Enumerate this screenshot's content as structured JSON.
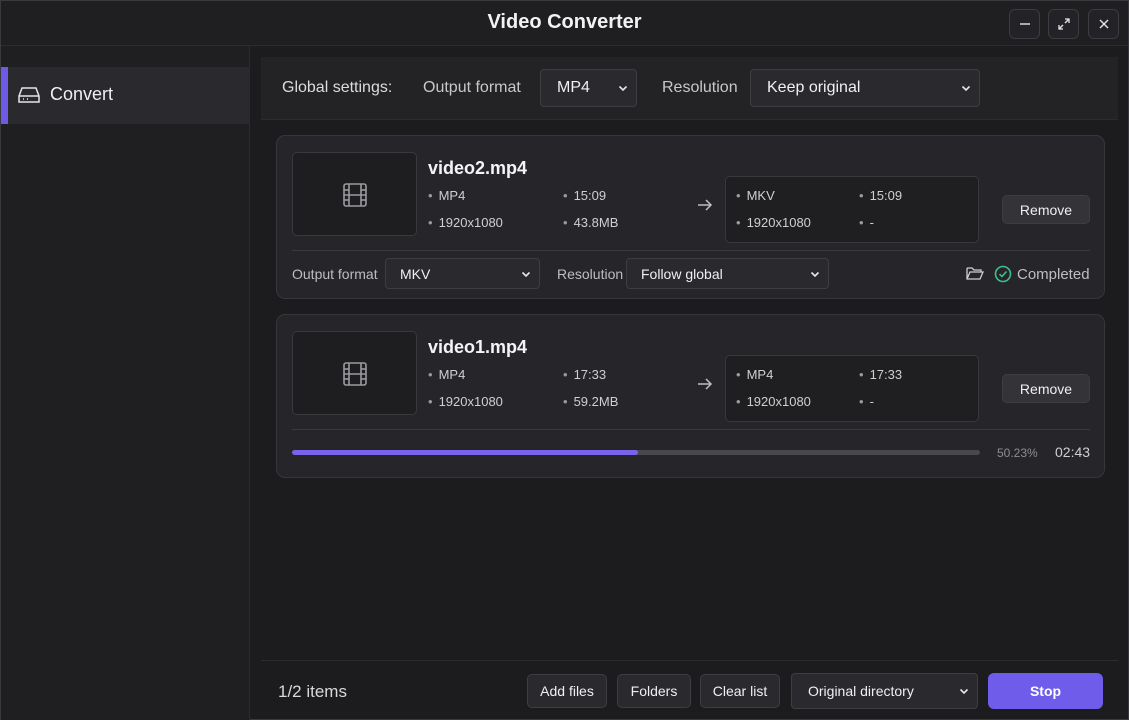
{
  "window": {
    "title": "Video Converter",
    "controls": [
      "minimize-icon",
      "maximize-icon",
      "close-icon"
    ]
  },
  "sidebar": {
    "items": [
      {
        "label": "Convert",
        "icon": "drive-icon",
        "active": true
      }
    ]
  },
  "global": {
    "title": "Global settings:",
    "output_format_label": "Output format",
    "output_format_value": "MP4",
    "resolution_label": "Resolution",
    "resolution_value": "Keep original"
  },
  "items": [
    {
      "name": "video2.mp4",
      "source": {
        "format": "MP4",
        "duration": "15:09",
        "resolution": "1920x1080",
        "size": "43.8MB"
      },
      "target": {
        "format": "MKV",
        "duration": "15:09",
        "resolution": "1920x1080",
        "size": "-"
      },
      "remove_label": "Remove",
      "output_format_label": "Output format",
      "output_format_value": "MKV",
      "resolution_label": "Resolution",
      "resolution_value": "Follow global",
      "status": "Completed"
    },
    {
      "name": "video1.mp4",
      "source": {
        "format": "MP4",
        "duration": "17:33",
        "resolution": "1920x1080",
        "size": "59.2MB"
      },
      "target": {
        "format": "MP4",
        "duration": "17:33",
        "resolution": "1920x1080",
        "size": "-"
      },
      "remove_label": "Remove",
      "progress_text": "50.23%",
      "progress": 0.5023,
      "eta": "02:43"
    }
  ],
  "footer": {
    "count": "1/2 items",
    "add_files": "Add files",
    "folders": "Folders",
    "clear_list": "Clear list",
    "output_dir": "Original directory",
    "stop": "Stop"
  },
  "colors": {
    "accent": "#6f5cea",
    "success": "#3fbf8a"
  }
}
